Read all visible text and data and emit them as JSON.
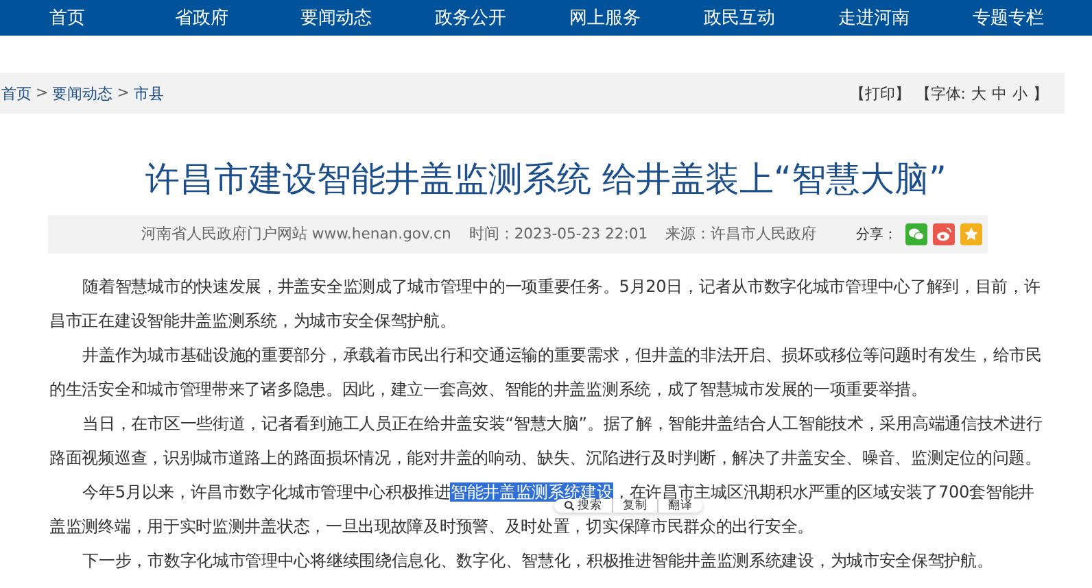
{
  "nav": [
    {
      "label": "首页"
    },
    {
      "label": "省政府"
    },
    {
      "label": "要闻动态"
    },
    {
      "label": "政务公开"
    },
    {
      "label": "网上服务"
    },
    {
      "label": "政民互动"
    },
    {
      "label": "走进河南"
    },
    {
      "label": "专题专栏"
    }
  ],
  "breadcrumb": {
    "items": [
      "首页",
      "要闻动态",
      "市县"
    ],
    "separator": ">"
  },
  "tools": {
    "print": "【打印】",
    "font_label": "【字体:",
    "font_sizes": [
      "大",
      "中",
      "小"
    ],
    "close": "】"
  },
  "article": {
    "title": "许昌市建设智能井盖监测系统 给井盖装上“智慧大脑”",
    "meta": {
      "site": "河南省人民政府门户网站 www.henan.gov.cn",
      "time": "时间：2023-05-23 22:01",
      "source": "来源：许昌市人民政府",
      "share_label": "分享："
    },
    "paragraphs": [
      [
        {
          "text": "随着智慧城市的快速发展，井盖安全监测成了城市管理中的一项重要任务。5月20日，记者从市数字化城市管理中心了解到，目前，许昌市正在建设智能井盖监测系统，为城市安全保驾护航。",
          "selected": false
        }
      ],
      [
        {
          "text": "井盖作为城市基础设施的重要部分，承载着市民出行和交通运输的重要需求，但井盖的非法开启、损坏或移位等问题时有发生，给市民的生活安全和城市管理带来了诸多隐患。因此，建立一套高效、智能的井盖监测系统，成了智慧城市发展的一项重要举措。",
          "selected": false
        }
      ],
      [
        {
          "text": "当日，在市区一些街道，记者看到施工人员正在给井盖安装“智慧大脑”。据了解，智能井盖结合人工智能技术，采用高端通信技术进行路面视频巡查，识别城市道路上的路面损坏情况，能对井盖的响动、缺失、沉陷进行及时判断，解决了井盖安全、噪音、监测定位的问题。",
          "selected": false
        }
      ],
      [
        {
          "text": "今年5月以来，许昌市数字化城市管理中心积极推进",
          "selected": false
        },
        {
          "text": "智能井盖监测系统建设",
          "selected": true
        },
        {
          "text": "，在许昌市主城区汛期积水严重的区域安装了700套智能井盖监测终端，用于实时监测井盖状态，一旦出现故障及时预警、及时处置，切实保障市民群众的出行安全。",
          "selected": false
        }
      ],
      [
        {
          "text": "下一步，市数字化城市管理中心将继续围绕信息化、数字化、智慧化，积极推进智能井盖监测系统建设，为城市安全保驾护航。",
          "selected": false
        }
      ]
    ]
  },
  "selection_popup": {
    "items": [
      {
        "label": "搜索",
        "kind": "search"
      },
      {
        "label": "复制",
        "kind": "plain"
      },
      {
        "label": "翻译",
        "kind": "plain"
      }
    ]
  }
}
